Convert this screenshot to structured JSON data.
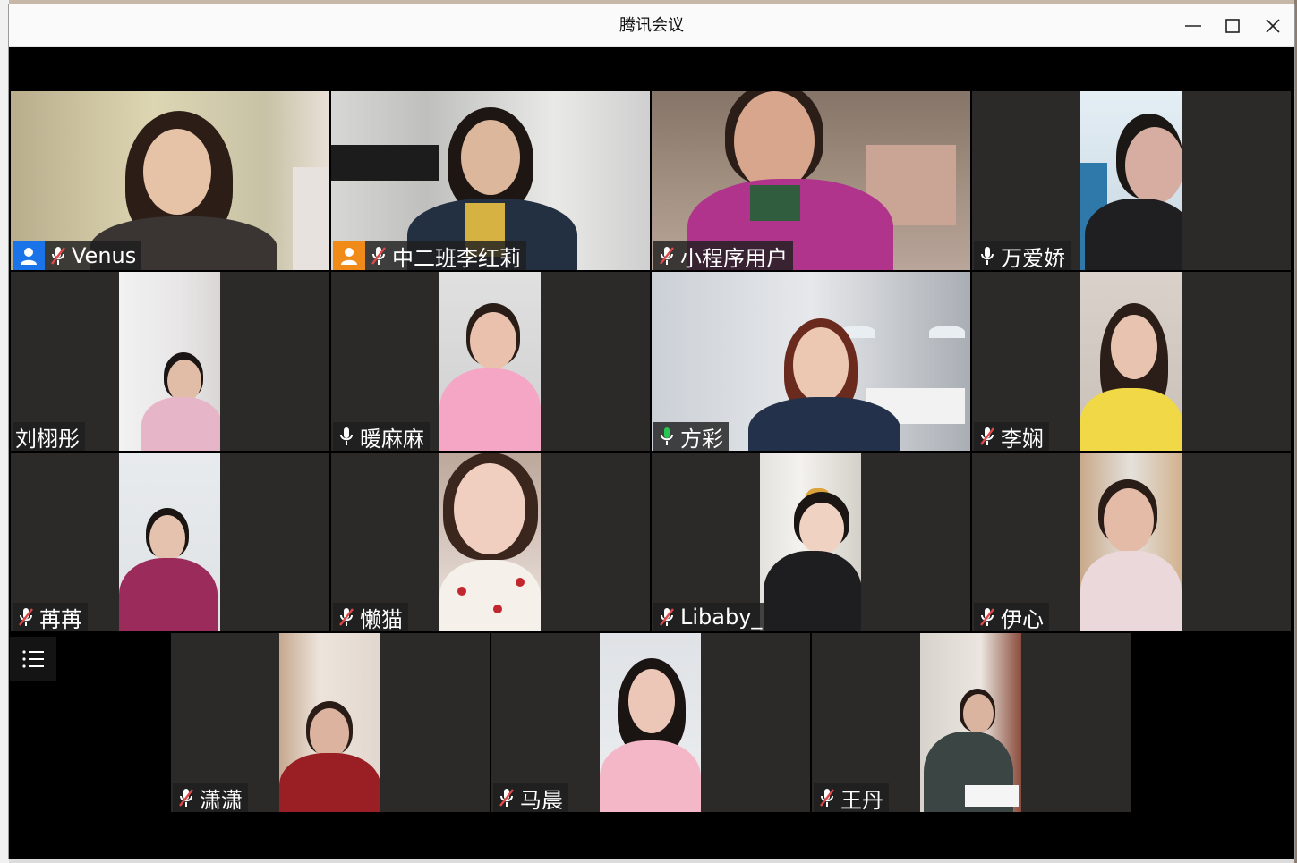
{
  "window": {
    "title": "腾讯会议"
  },
  "colors": {
    "host_blue": "#1a73e8",
    "host_orange": "#f08a18",
    "speaking_green": "#27c653",
    "muted_red": "#e04848"
  },
  "participants": [
    {
      "name": "Venus",
      "role": "host",
      "mic": "muted"
    },
    {
      "name": "中二班李红莉",
      "role": "cohost",
      "mic": "muted"
    },
    {
      "name": "小程序用户",
      "mic": "muted"
    },
    {
      "name": "万爱娇",
      "mic": "on"
    },
    {
      "name": "刘栩彤",
      "mic": "none"
    },
    {
      "name": "暖麻麻",
      "mic": "on"
    },
    {
      "name": "方彩",
      "mic": "speaking"
    },
    {
      "name": "李娴",
      "mic": "muted"
    },
    {
      "name": "苒苒",
      "mic": "muted"
    },
    {
      "name": "懒猫",
      "mic": "muted"
    },
    {
      "name": "Libaby_",
      "mic": "muted"
    },
    {
      "name": "伊心",
      "mic": "muted"
    },
    {
      "name": "潇潇",
      "mic": "muted"
    },
    {
      "name": "马晨",
      "mic": "muted"
    },
    {
      "name": "王丹",
      "mic": "muted"
    }
  ],
  "toolbar": {
    "menu_icon": "list-menu-icon"
  }
}
